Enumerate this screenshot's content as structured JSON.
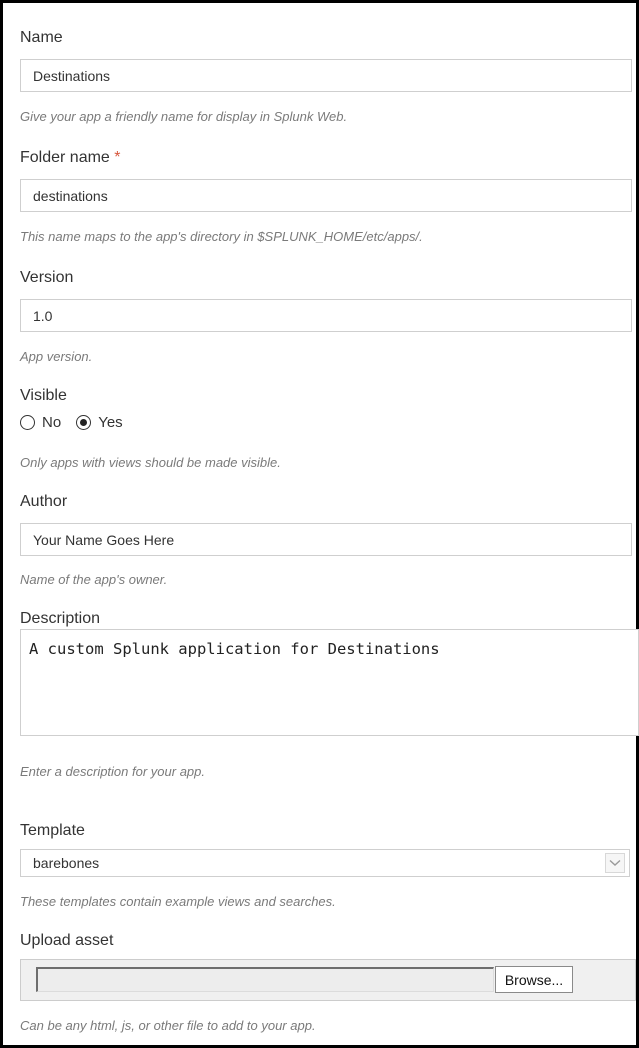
{
  "form": {
    "name": {
      "label": "Name",
      "value": "Destinations",
      "help": "Give your app a friendly name for display in Splunk Web."
    },
    "folder_name": {
      "label": "Folder name",
      "required_marker": "*",
      "value": "destinations",
      "help": "This name maps to the app's directory in $SPLUNK_HOME/etc/apps/."
    },
    "version": {
      "label": "Version",
      "value": "1.0",
      "help": "App version."
    },
    "visible": {
      "label": "Visible",
      "options": [
        {
          "label": "No",
          "checked": false
        },
        {
          "label": "Yes",
          "checked": true
        }
      ],
      "help": "Only apps with views should be made visible."
    },
    "author": {
      "label": "Author",
      "value": "Your Name Goes Here",
      "help": "Name of the app's owner."
    },
    "description": {
      "label": "Description",
      "value": "A custom Splunk application for Destinations",
      "help": "Enter a description for your app."
    },
    "template": {
      "label": "Template",
      "selected": "barebones",
      "help": "These templates contain example views and searches."
    },
    "upload_asset": {
      "label": "Upload asset",
      "file_value": "",
      "browse_label": "Browse...",
      "help": "Can be any html, js, or other file to add to your app."
    }
  },
  "icons": {
    "select_arrow": "chevron-down-icon",
    "radio_selected": "radio-dot-icon"
  },
  "colors": {
    "required_asterisk": "#d6563c",
    "help_text": "#7a7a7a",
    "input_border": "#cfcfcf",
    "frame_border": "#000000"
  }
}
